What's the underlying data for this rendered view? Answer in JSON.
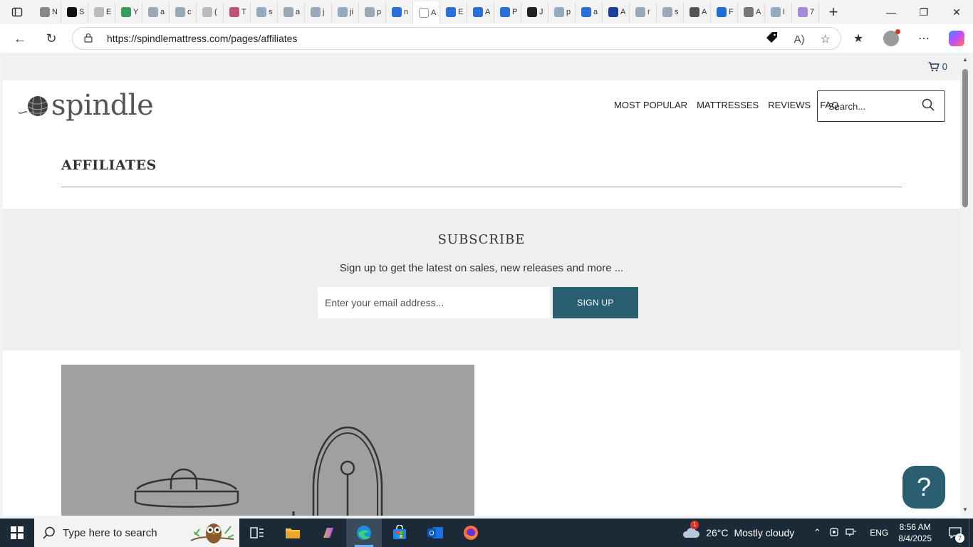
{
  "browser": {
    "tabs": [
      {
        "label": "N",
        "color": "#888"
      },
      {
        "label": "S",
        "color": "#111"
      },
      {
        "label": "E",
        "color": "#bbb"
      },
      {
        "label": "Y",
        "color": "#3a9d5a"
      },
      {
        "label": "a",
        "color": "#9ab"
      },
      {
        "label": "c",
        "color": "#9ab"
      },
      {
        "label": "(",
        "color": "#bbb"
      },
      {
        "label": "T",
        "color": "#b57"
      },
      {
        "label": "s",
        "color": "#9ab"
      },
      {
        "label": "a",
        "color": "#9ab"
      },
      {
        "label": "j",
        "color": "#9ab"
      },
      {
        "label": "ji",
        "color": "#9ab"
      },
      {
        "label": "p",
        "color": "#9ab"
      },
      {
        "label": "n",
        "color": "#2a6fd6"
      },
      {
        "label": "A",
        "color": "#fff",
        "active": true
      },
      {
        "label": "E",
        "color": "#2a6fd6"
      },
      {
        "label": "A",
        "color": "#2a6fd6"
      },
      {
        "label": "P",
        "color": "#2a6fd6"
      },
      {
        "label": "J",
        "color": "#222"
      },
      {
        "label": "p",
        "color": "#9ab"
      },
      {
        "label": "a",
        "color": "#2a6fd6"
      },
      {
        "label": "A",
        "color": "#1a3f9d"
      },
      {
        "label": "r",
        "color": "#9ab"
      },
      {
        "label": "s",
        "color": "#9ab"
      },
      {
        "label": "A",
        "color": "#555"
      },
      {
        "label": "F",
        "color": "#1d6fd6"
      },
      {
        "label": "A",
        "color": "#777"
      },
      {
        "label": "I",
        "color": "#9ab"
      },
      {
        "label": "7",
        "color": "#a78bd6"
      }
    ],
    "url": "https://spindlemattress.com/pages/affiliates"
  },
  "site": {
    "cart_count": "0",
    "logo_text": "spindle",
    "nav": [
      "MOST POPULAR",
      "MATTRESSES",
      "REVIEWS",
      "FAQ"
    ],
    "search_placeholder": "Search...",
    "page_title": "AFFILIATES",
    "subscribe": {
      "title": "SUBSCRIBE",
      "text": "Sign up to get the latest on sales, new releases and more ...",
      "email_placeholder": "Enter your email address...",
      "button": "SIGN UP"
    },
    "help_label": "?"
  },
  "taskbar": {
    "search_placeholder": "Type here to search",
    "weather_temp": "26°C",
    "weather_desc": "Mostly cloudy",
    "weather_badge": "1",
    "lang": "ENG",
    "time": "8:56 AM",
    "date": "8/4/2025",
    "notifications": "7"
  }
}
